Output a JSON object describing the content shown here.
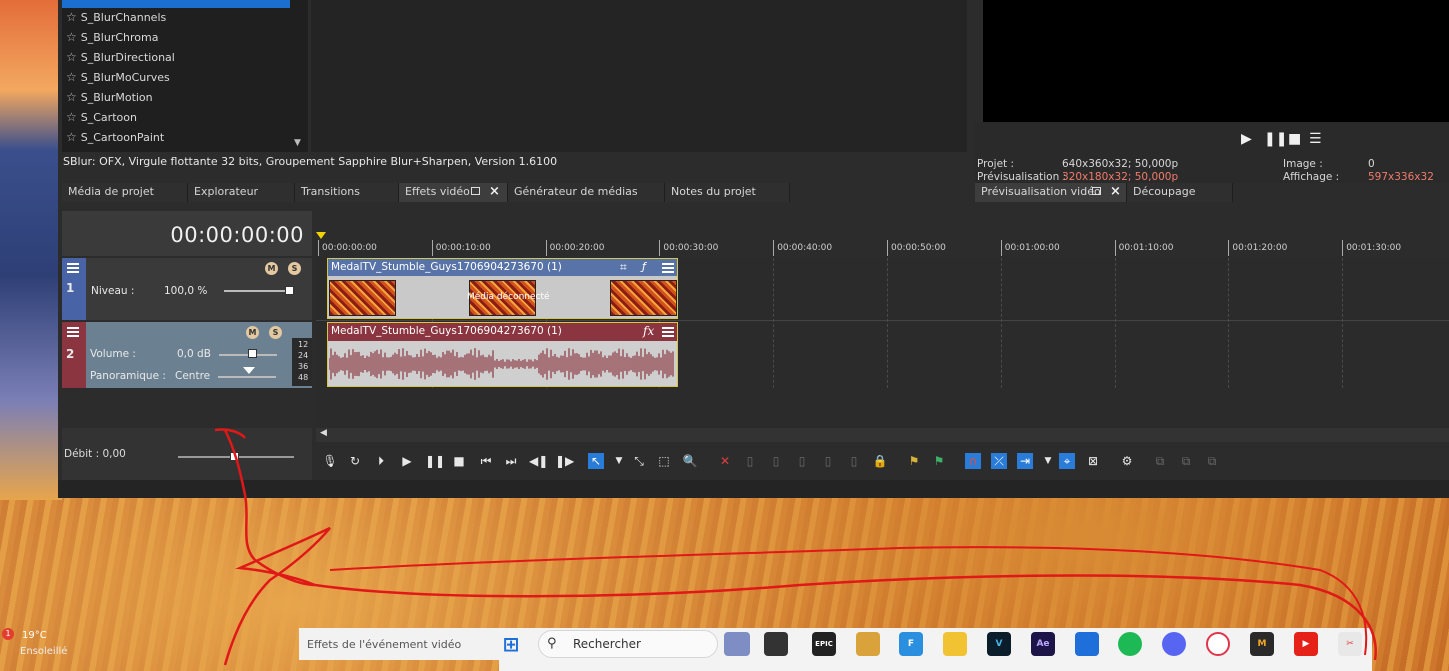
{
  "effects_list": {
    "items": [
      "S_BlurChannels",
      "S_BlurChroma",
      "S_BlurDirectional",
      "S_BlurMoCurves",
      "S_BlurMotion",
      "S_Cartoon",
      "S_CartoonPaint"
    ],
    "description": "SBlur: OFX, Virgule flottante 32 bits, Groupement  Sapphire Blur+Sharpen, Version 1.6100"
  },
  "tabs": {
    "project_media": "Média de projet",
    "explorer": "Explorateur",
    "transitions": "Transitions",
    "video_fx": "Effets vidéo",
    "media_generators": "Générateur de médias",
    "project_notes": "Notes du projet",
    "video_preview": "Prévisualisation vidéo",
    "trimmer": "Découpage"
  },
  "preview": {
    "project_label": "Projet :",
    "project_value": "640x360x32; 50,000p",
    "preview_label": "Prévisualisation :",
    "preview_value": "320x180x32; 50,000p",
    "frame_label": "Image :",
    "frame_value": "0",
    "display_label": "Affichage :",
    "display_value": "597x336x32"
  },
  "timeline": {
    "timecode": "00:00:00:00",
    "ruler": [
      "00:00:00:00",
      "00:00:10:00",
      "00:00:20:00",
      "00:00:30:00",
      "00:00:40:00",
      "00:00:50:00",
      "00:01:00:00",
      "00:01:10:00",
      "00:01:20:00",
      "00:01:30:00"
    ],
    "track1": {
      "number": "1",
      "level_label": "Niveau :",
      "level_value": "100,0 %"
    },
    "track2": {
      "number": "2",
      "volume_label": "Volume :",
      "volume_value": "0,0 dB",
      "pan_label": "Panoramique :",
      "pan_value": "Centre",
      "meter": [
        "12",
        "24",
        "36",
        "48"
      ]
    },
    "video_clip": {
      "title": "MedalTV_Stumble_Guys1706904273670 (1)",
      "offline": "Média déconnecté"
    },
    "audio_clip": {
      "title": "MedalTV_Stumble_Guys1706904273670 (1)",
      "fx": "fx"
    },
    "rate_label": "Débit : 0,00"
  },
  "taskbar": {
    "search_placeholder": "Effets de l'événement vidéo",
    "search_button": "Rechercher",
    "weather_temp": "19°C",
    "weather_desc": "Ensoleillé",
    "notification_count": "1",
    "apps": [
      "EPIC",
      "F",
      "V",
      "Ae"
    ]
  },
  "colors": {
    "accent": "#2a7cd9",
    "video_track": "#4964a6",
    "audio_track": "#8a3540",
    "highlight_text": "#f07c6a",
    "annotation": "#e01818"
  }
}
